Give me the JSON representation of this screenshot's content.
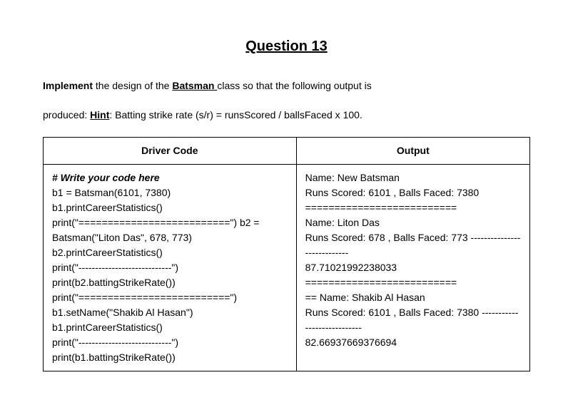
{
  "title": "Question 13",
  "intro_implement": "Implement",
  "intro_text1": " the design of the ",
  "intro_batsman": "Batsman ",
  "intro_text2": "class so that the following output is",
  "hint_prefix": "produced: ",
  "hint_label": "Hint",
  "hint_text": ": Batting strike rate (s/r) = runsScored / ballsFaced x 100.",
  "table": {
    "header_driver": "Driver Code",
    "header_output": "Output",
    "comment": "# Write your code here",
    "driver_lines": "b1 = Batsman(6101, 7380)\nb1.printCareerStatistics()\nprint(\"==========================\") b2 = Batsman(\"Liton Das\", 678, 773)\nb2.printCareerStatistics()\nprint(\"----------------------------\")\nprint(b2.battingStrikeRate())\nprint(\"==========================\") b1.setName(\"Shakib Al Hasan\")\nb1.printCareerStatistics()\nprint(\"----------------------------\")\nprint(b1.battingStrikeRate())",
    "output_lines": "Name: New Batsman\nRuns Scored: 6101 , Balls Faced: 7380\n==========================\nName: Liton Das\nRuns Scored: 678 , Balls Faced: 773 ----------------------------\n87.71021992238033\n==========================\n== Name: Shakib Al Hasan\nRuns Scored: 6101 , Balls Faced: 7380 ----------------------------\n82.66937669376694"
  }
}
